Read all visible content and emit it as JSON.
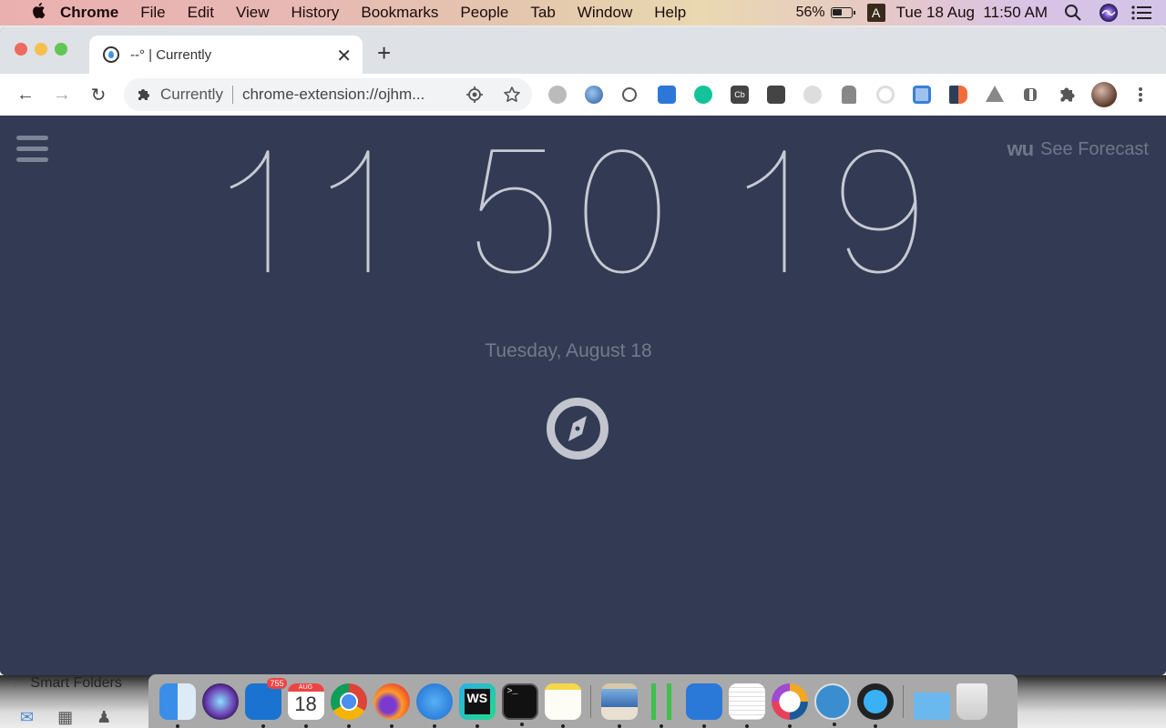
{
  "menubar": {
    "app_name": "Chrome",
    "items": [
      "File",
      "Edit",
      "View",
      "History",
      "Bookmarks",
      "People",
      "Tab",
      "Window",
      "Help"
    ],
    "battery": "56%",
    "battery_level": 0.56,
    "input_source": "A",
    "datetime": "Tue 18 Aug  11:50 AM"
  },
  "browser": {
    "tab": {
      "title": "--° | Currently"
    },
    "omnibox": {
      "site_name": "Currently",
      "url": "chrome-extension://ojhm..."
    },
    "extensions": [
      "globe",
      "thunderbird-mail",
      "currently-drop",
      "printer-lock",
      "grammarly",
      "cb",
      "lightbulb",
      "loop",
      "getpocket",
      "target",
      "grid-tool",
      "megaphone",
      "google-drive",
      "apps-grid",
      "extensions-puzzle"
    ]
  },
  "page": {
    "clock": {
      "hours": "11",
      "minutes": "50",
      "seconds": "19"
    },
    "date": "Tuesday, August 18",
    "forecast_logo": "wu",
    "forecast_label": "See Forecast"
  },
  "background_app": {
    "sidebar_label": "Smart Folders"
  },
  "dock": {
    "outlook_badge": "755",
    "calendar_month": "AUG",
    "calendar_day": "18",
    "apps": [
      "Finder",
      "Siri",
      "Outlook",
      "Calendar",
      "Chrome",
      "Firefox",
      "Safari",
      "WebStorm",
      "Terminal",
      "Notes",
      "Preview",
      "Sourcetree",
      "Xcode",
      "TextEdit",
      "Webex",
      "Fork",
      "QuickTime Player",
      "Downloads",
      "Trash"
    ]
  }
}
